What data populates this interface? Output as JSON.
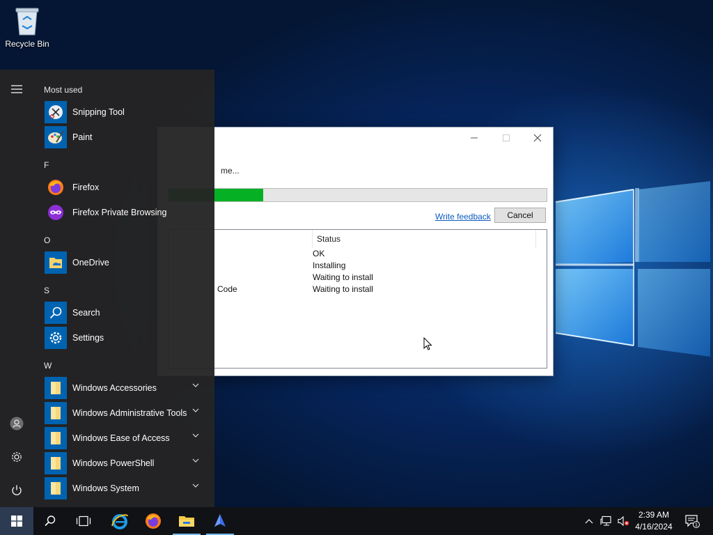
{
  "desktop": {
    "recycle_bin_label": "Recycle Bin"
  },
  "dialog": {
    "status_text": "me...",
    "progress_fraction": 0.25,
    "feedback_link": "Write feedback",
    "cancel_label": "Cancel",
    "column_status": "Status",
    "rows": [
      {
        "name": "",
        "status": "OK"
      },
      {
        "name": "",
        "status": "Installing"
      },
      {
        "name": "",
        "status": "Waiting to install"
      },
      {
        "name": "Code",
        "status": "Waiting to install"
      }
    ]
  },
  "start_menu": {
    "most_used_label": "Most used",
    "sections": {
      "f": "F",
      "o": "O",
      "s": "S",
      "w": "W"
    },
    "apps": {
      "snipping_tool": "Snipping Tool",
      "paint": "Paint",
      "firefox": "Firefox",
      "firefox_private": "Firefox Private Browsing",
      "onedrive": "OneDrive",
      "search": "Search",
      "settings": "Settings",
      "win_accessories": "Windows Accessories",
      "win_admin_tools": "Windows Administrative Tools",
      "win_ease": "Windows Ease of Access",
      "win_powershell": "Windows PowerShell",
      "win_system": "Windows System"
    }
  },
  "taskbar": {
    "time": "2:39 AM",
    "date": "4/16/2024",
    "notification_count": "1"
  },
  "colors": {
    "accent": "#0063b1",
    "progress": "#06b025",
    "link": "#0b5bc0",
    "start_bg": "#242424",
    "taskbar_bg": "#101216"
  }
}
